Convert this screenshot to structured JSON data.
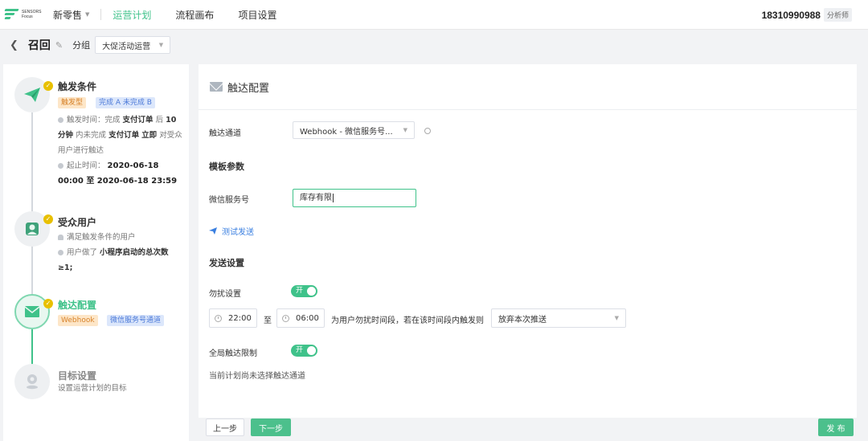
{
  "colors": {
    "accent": "#3fc28a",
    "tag_orange": "#d7822a",
    "tag_blue": "#4b79d8",
    "link": "#3a7fe0"
  },
  "topnav": {
    "logo_line1": "SENSORS",
    "logo_line2": "Focus",
    "store": "新零售",
    "items": [
      "运营计划",
      "流程画布",
      "项目设置"
    ],
    "phone": "18310990988",
    "role": "分析师"
  },
  "subheader": {
    "title": "召回",
    "group_label": "分组",
    "group_value": "大促活动运营"
  },
  "steps": {
    "trigger": {
      "title": "触发条件",
      "tag1": "触发型",
      "tag2": "完成 A 未完成 B",
      "time_label": "触发时间：完成",
      "event_a": "支付订单",
      "after": "后",
      "duration": "10 分钟",
      "within_not": "内未完成",
      "event_b": "支付订单",
      "immediately": "立即",
      "suffix": "对受众用户进行触达",
      "range_label": "起止时间：",
      "range_start": "2020-06-18",
      "range_rest": "00:00 至 2020-06-18 23:59"
    },
    "audience": {
      "title": "受众用户",
      "line1": "满足触发条件的用户",
      "line2_prefix": "用户做了",
      "line2_bold": "小程序启动的总次数",
      "line2_suffix": "≥1;"
    },
    "reach": {
      "title": "触达配置",
      "tag1": "Webhook",
      "tag2": "微信服务号通道"
    },
    "goal": {
      "title": "目标设置",
      "desc": "设置运营计划的目标"
    }
  },
  "main": {
    "title": "触达配置",
    "channel_label": "触达通道",
    "channel_value": "Webhook - 微信服务号...",
    "template_section": "模板参数",
    "wechat_label": "微信服务号",
    "wechat_value": "库存有限",
    "test_send": "测试发送",
    "send_section": "发送设置",
    "dnd_label": "勿扰设置",
    "dnd_toggle": "开",
    "time_start": "22:00",
    "time_to": "至",
    "time_end": "06:00",
    "dnd_text": "为用户勿扰时间段，若在该时间段内触发则",
    "dnd_action": "放弃本次推送",
    "global_label": "全局触达限制",
    "global_toggle": "开",
    "global_note": "当前计划尚未选择触达通道"
  },
  "footer": {
    "prev": "上一步",
    "next": "下一步",
    "publish": "发 布"
  }
}
